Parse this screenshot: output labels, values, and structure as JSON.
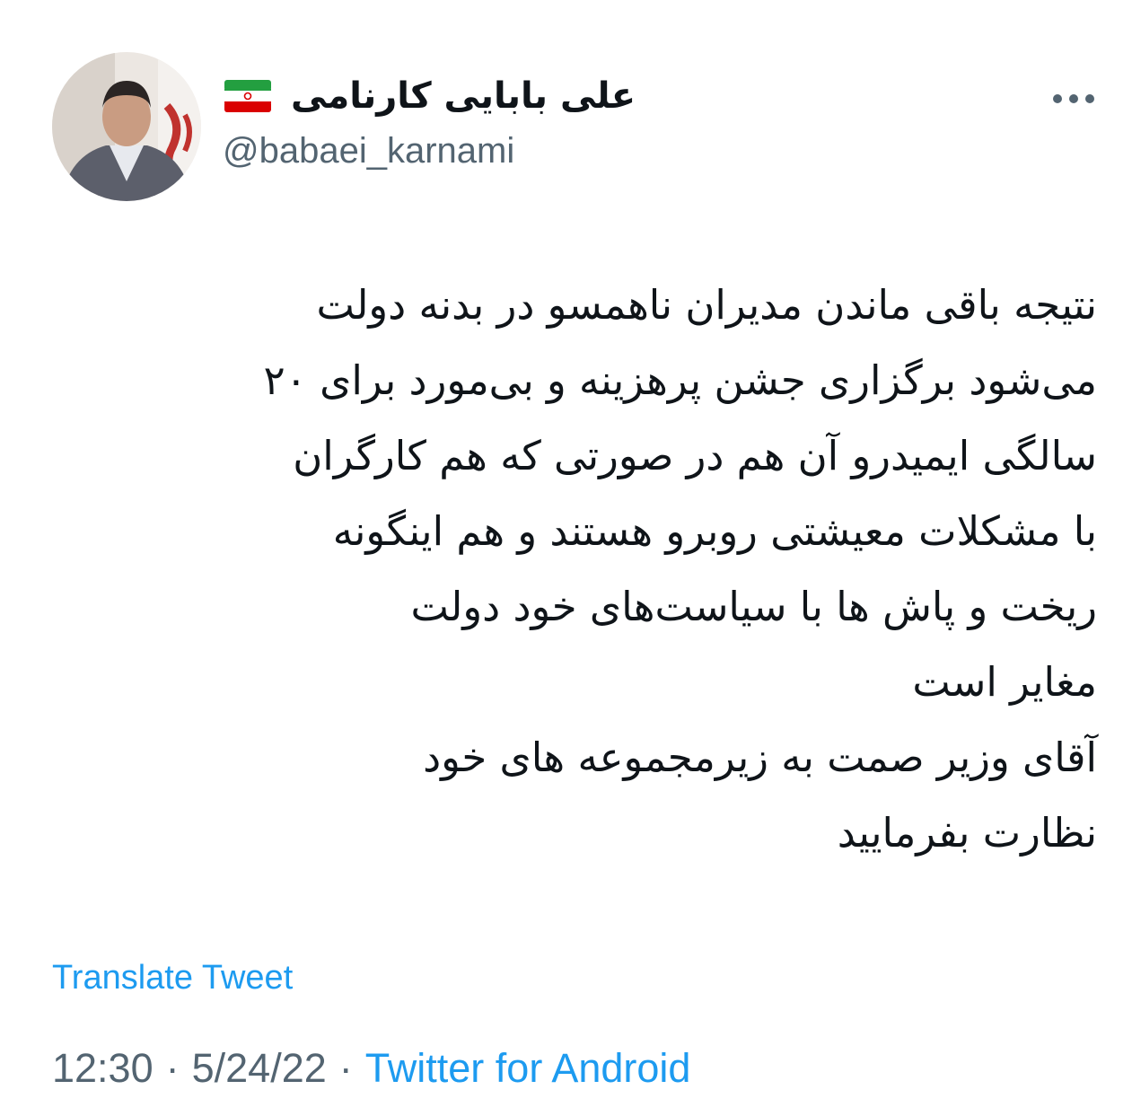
{
  "author": {
    "display_name": "علی بابایی کارنامی",
    "handle": "@babaei_karnami",
    "flag_icon": "iran-flag-icon"
  },
  "tweet": {
    "lines": [
      "نتیجه باقی ماندن مدیران ناهمسو در بدنه دولت",
      "می‌شود برگزاری جشن پرهزینه و بی‌مورد برای ۲۰",
      "سالگی ایمیدرو آن هم در صورتی که هم کارگران",
      "با مشکلات معیشتی روبرو هستند و هم اینگونه",
      "ریخت و پاش ها با سیاست‌های خود دولت",
      "مغایر است",
      "آقای وزیر صمت به زیرمجموعه های خود",
      "نظارت بفرمایید"
    ],
    "translate_label": "Translate Tweet"
  },
  "meta": {
    "time": "12:30",
    "date": "5/24/22",
    "separator": "·",
    "source": "Twitter for Android"
  },
  "colors": {
    "text": "#0f1419",
    "secondary": "#536471",
    "link": "#1d9bf0"
  },
  "icons": {
    "more": "more-horizontal-icon",
    "avatar": "profile-avatar"
  }
}
